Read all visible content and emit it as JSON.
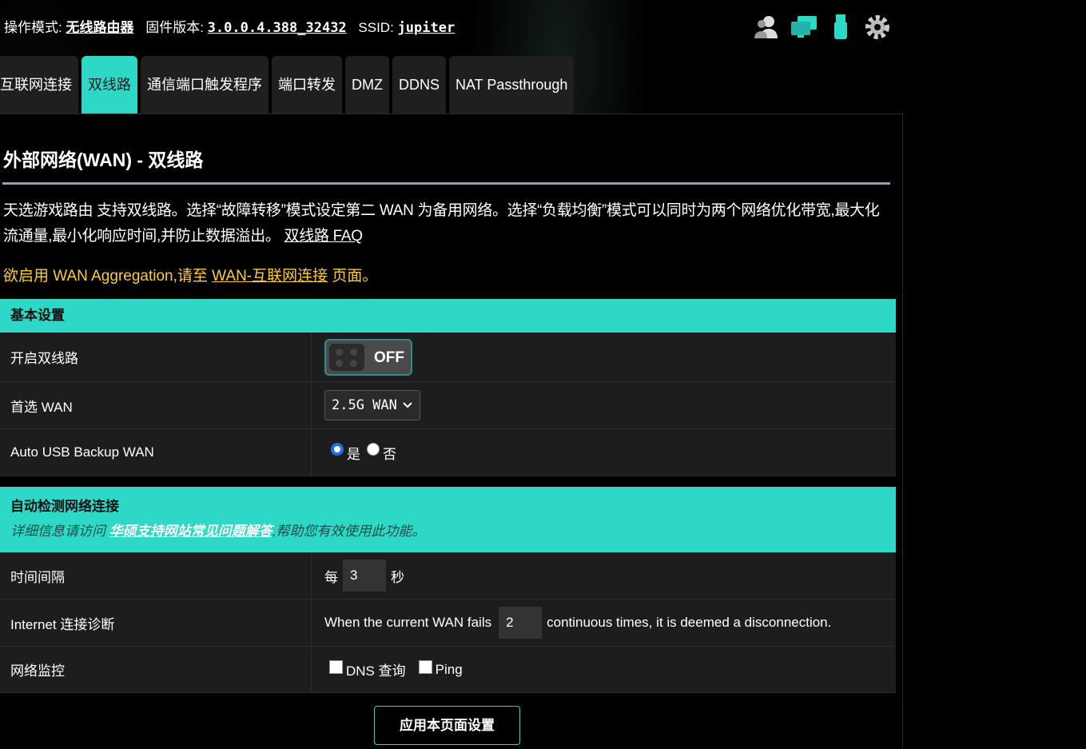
{
  "topbar": {
    "mode_label": "操作模式:",
    "mode_value": "无线路由器",
    "firmware_label": "固件版本:",
    "firmware_value": "3.0.0.4.388_32432",
    "ssid_label": "SSID:",
    "ssid_value": "jupiter",
    "icons": [
      "users-icon",
      "network-monitor-icon",
      "usb-icon",
      "settings-gear-icon"
    ]
  },
  "tabs": [
    {
      "label": "互联网连接",
      "active": false
    },
    {
      "label": "双线路",
      "active": true
    },
    {
      "label": "通信端口触发程序",
      "active": false
    },
    {
      "label": "端口转发",
      "active": false
    },
    {
      "label": "DMZ",
      "active": false
    },
    {
      "label": "DDNS",
      "active": false
    },
    {
      "label": "NAT Passthrough",
      "active": false
    }
  ],
  "page": {
    "title": "外部网络(WAN) - 双线路",
    "desc_text": "天选游戏路由 支持双线路。选择“故障转移”模式设定第二 WAN 为备用网络。选择“负载均衡”模式可以同时为两个网络优化带宽,最大化流通量,最小化响应时间,并防止数据溢出。",
    "desc_link": "双线路 FAQ",
    "notice_prefix": "欲启用 WAN Aggregation,请至 ",
    "notice_link": "WAN-互联网连接",
    "notice_suffix": " 页面。"
  },
  "basic": {
    "header": "基本设置",
    "enable_label": "开启双线路",
    "enable_state": "OFF",
    "primary_wan_label": "首选 WAN",
    "primary_wan_value": "2.5G WAN",
    "usb_backup_label": "Auto USB Backup WAN",
    "usb_yes": "是",
    "usb_no": "否"
  },
  "detect": {
    "header": "自动检测网络连接",
    "sub_prefix": "详细信息请访问 ",
    "sub_link": "华硕支持网站常见问题解答",
    "sub_suffix": ",帮助您有效使用此功能。",
    "interval_label": "时间间隔",
    "interval_prefix": "每",
    "interval_value": "3",
    "interval_unit": "秒",
    "diag_label": "Internet 连接诊断",
    "diag_prefix": "When the current WAN fails",
    "diag_value": "2",
    "diag_suffix": "continuous times, it is deemed a disconnection.",
    "monitor_label": "网络监控",
    "monitor_dns": "DNS 查询",
    "monitor_ping": "Ping"
  },
  "apply_label": "应用本页面设置"
}
